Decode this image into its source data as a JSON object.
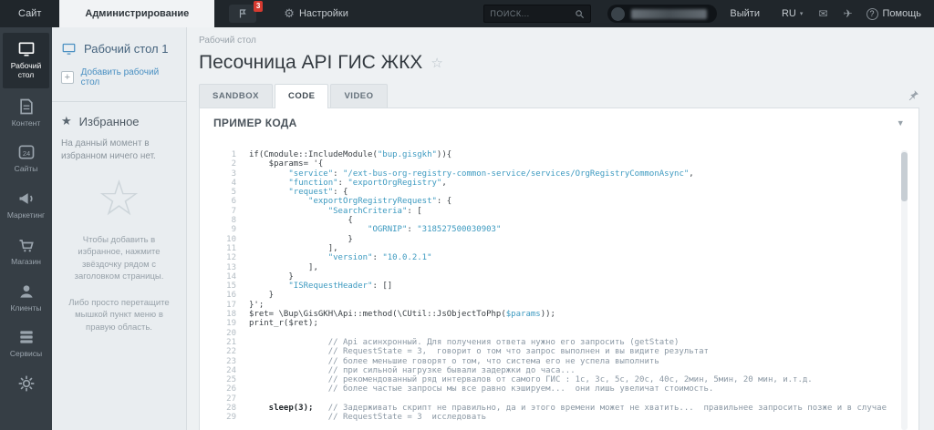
{
  "topbar": {
    "site_tab": "Сайт",
    "admin_tab": "Администрирование",
    "notif_count": "3",
    "settings": "Настройки",
    "search_placeholder": "ПОИСК...",
    "logout": "Выйти",
    "lang": "RU",
    "help": "Помощь"
  },
  "iconbar": {
    "items": [
      {
        "key": "desktop",
        "label": "Рабочий стол",
        "icon": "desktop-icon",
        "active": true
      },
      {
        "key": "content",
        "label": "Контент",
        "icon": "content-icon",
        "active": false
      },
      {
        "key": "sites",
        "label": "Сайты",
        "icon": "sites-icon",
        "active": false
      },
      {
        "key": "marketing",
        "label": "Маркетинг",
        "icon": "marketing-icon",
        "active": false
      },
      {
        "key": "store",
        "label": "Магазин",
        "icon": "store-icon",
        "active": false
      },
      {
        "key": "clients",
        "label": "Клиенты",
        "icon": "clients-icon",
        "active": false
      },
      {
        "key": "services",
        "label": "Сервисы",
        "icon": "services-icon",
        "active": false
      },
      {
        "key": "more",
        "label": "",
        "icon": "gear-icon",
        "active": false
      }
    ]
  },
  "sidebar": {
    "desktop_label": "Рабочий стол 1",
    "add_desktop": "Добавить рабочий стол",
    "favorites_title": "Избранное",
    "favorites_empty": "На данный момент в избранном ничего нет.",
    "hint_add": "Чтобы добавить в избранное, нажмите звёздочку рядом с заголовком страницы.",
    "hint_drag": "Либо просто перетащите мышкой пункт меню в правую область."
  },
  "main": {
    "breadcrumb": "Рабочий стол",
    "title": "Песочница API ГИС ЖКХ",
    "tabs": [
      {
        "label": "SANDBOX",
        "active": false
      },
      {
        "label": "CODE",
        "active": true
      },
      {
        "label": "VIDEO",
        "active": false
      }
    ],
    "panel_title": "ПРИМЕР КОДА"
  },
  "code": {
    "lines": [
      [
        [
          "p",
          "if(Cmodule::IncludeModule("
        ],
        [
          "s",
          "\"bup.gisgkh\""
        ],
        [
          "p",
          ")){"
        ]
      ],
      [
        [
          "p",
          "    $params= '{"
        ]
      ],
      [
        [
          "p",
          "        "
        ],
        [
          "s",
          "\"service\""
        ],
        [
          "p",
          ": "
        ],
        [
          "s",
          "\"/ext-bus-org-registry-common-service/services/OrgRegistryCommonAsync\""
        ],
        [
          "p",
          ","
        ]
      ],
      [
        [
          "p",
          "        "
        ],
        [
          "s",
          "\"function\""
        ],
        [
          "p",
          ": "
        ],
        [
          "s",
          "\"exportOrgRegistry\""
        ],
        [
          "p",
          ","
        ]
      ],
      [
        [
          "p",
          "        "
        ],
        [
          "s",
          "\"request\""
        ],
        [
          "p",
          ": {"
        ]
      ],
      [
        [
          "p",
          "            "
        ],
        [
          "s",
          "\"exportOrgRegistryRequest\""
        ],
        [
          "p",
          ": {"
        ]
      ],
      [
        [
          "p",
          "                "
        ],
        [
          "s",
          "\"SearchCriteria\""
        ],
        [
          "p",
          ": ["
        ]
      ],
      [
        [
          "p",
          "                    {"
        ]
      ],
      [
        [
          "p",
          "                        "
        ],
        [
          "s",
          "\"OGRNIP\""
        ],
        [
          "p",
          ": "
        ],
        [
          "s",
          "\"318527500030903\""
        ]
      ],
      [
        [
          "p",
          "                    }"
        ]
      ],
      [
        [
          "p",
          "                ],"
        ]
      ],
      [
        [
          "p",
          "                "
        ],
        [
          "s",
          "\"version\""
        ],
        [
          "p",
          ": "
        ],
        [
          "s",
          "\"10.0.2.1\""
        ]
      ],
      [
        [
          "p",
          "            ],"
        ]
      ],
      [
        [
          "p",
          "        }"
        ]
      ],
      [
        [
          "p",
          "        "
        ],
        [
          "s",
          "\"ISRequestHeader\""
        ],
        [
          "p",
          ": []"
        ]
      ],
      [
        [
          "p",
          "    }"
        ]
      ],
      [
        [
          "p",
          "}';"
        ]
      ],
      [
        [
          "p",
          "$ret= \\Bup\\GisGKH\\Api::method(\\CUtil::JsObjectToPhp("
        ],
        [
          "v",
          "$params"
        ],
        [
          "p",
          "));"
        ]
      ],
      [
        [
          "p",
          "print_r($ret);"
        ]
      ],
      [],
      [
        [
          "c",
          "                // Api асинхронный. Для получения ответа нужно его запросить (getState)"
        ]
      ],
      [
        [
          "c",
          "                // RequestState = 3,  говорит о том что запрос выполнен и вы видите результат"
        ]
      ],
      [
        [
          "c",
          "                // более меньшие говорят о том, что система его не успела выполнить"
        ]
      ],
      [
        [
          "c",
          "                // при сильной нагрузке бывали задержки до часа..."
        ]
      ],
      [
        [
          "c",
          "                // рекомендованный ряд интервалов от самого ГИС : 1с, 3с, 5с, 20с, 40с, 2мин, 5мин, 20 мин, и.т.д."
        ]
      ],
      [
        [
          "c",
          "                // более частые запросы мы все равно кэшируем...  они лишь увеличат стоимость."
        ]
      ],
      [],
      [
        [
          "b",
          "    sleep(3);"
        ],
        [
          "c",
          "   // Задерживать скрипт не правильно, да и этого времени может не хватить...  правильнее запросить позже и в случае"
        ]
      ],
      [
        [
          "c",
          "                // RequestState = 3  исследовать"
        ]
      ]
    ]
  },
  "colors": {
    "topbar_bg": "#20262b",
    "iconbar_bg": "#363e45",
    "sidebar_bg": "#e9edf0",
    "string": "#3d9ac0",
    "comment": "#8b98a4",
    "badge": "#d63a30",
    "link_blue": "#4a90c2"
  }
}
